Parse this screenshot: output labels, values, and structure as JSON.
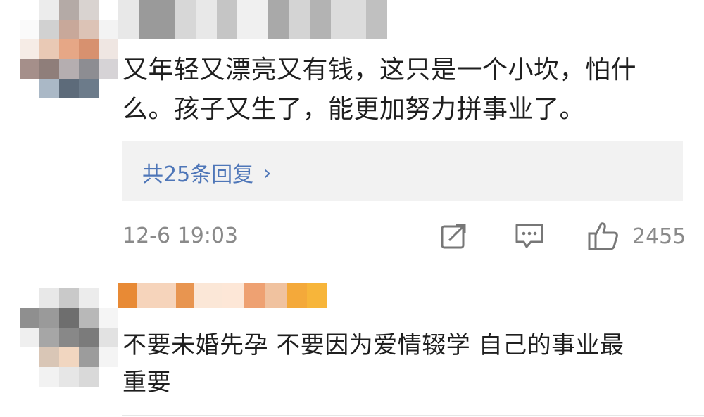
{
  "comments": [
    {
      "text_line1": "又年轻又漂亮又有钱，这只是一个小坎，怕什",
      "text_line2": "么。孩子又生了，能更加努力拼事业了。",
      "replies_label": "共25条回复",
      "replies_chevron": "›",
      "timestamp": "12-6 19:03",
      "like_count": "2455",
      "icons": [
        "repost-icon",
        "comment-icon",
        "like-icon"
      ],
      "accent_color": "#4e76b8"
    },
    {
      "text_line1": "不要未婚先孕 不要因为爱情辍学 自己的事业最",
      "text_line2": "重要"
    }
  ]
}
